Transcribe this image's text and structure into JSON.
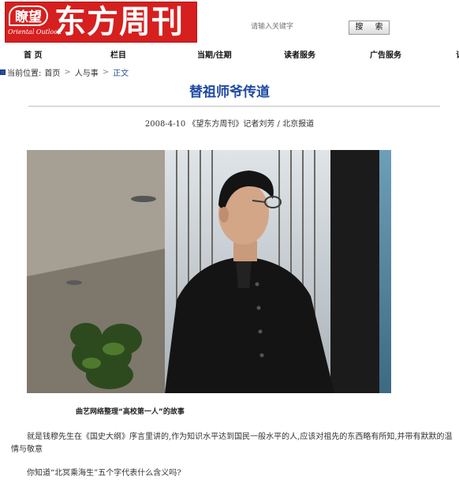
{
  "header": {
    "logo_badge": "瞭望",
    "logo_en": "Oriental Outlook",
    "logo_title": "东方周刊",
    "search_placeholder": "请输入关键字",
    "search_button": "搜 索"
  },
  "nav": {
    "items": [
      "首 页",
      "栏目",
      "当期/往期",
      "读者服务",
      "广告服务",
      "订"
    ]
  },
  "breadcrumb": {
    "prefix": "当前位置:",
    "items": [
      "首页",
      "人与事",
      "正文"
    ]
  },
  "article": {
    "title": "替祖师爷传道",
    "byline": "2008-4-10 《望东方周刊》记者刘芳 / 北京报道",
    "caption": "曲艺网络整理“高校第一人”的故事",
    "paragraphs": [
      "就是钱穆先生在《国史大纲》序言里讲的,作为知识水平达到国民一般水平的人,应该对祖先的东西略有所知,并带有默默的温情与敬意",
      "你知道“北冥乘海生”五个字代表什么含义吗?"
    ]
  },
  "colors": {
    "logo_red": "#d61f1f",
    "title_blue": "#1f4aa3",
    "breadcrumb_current": "#2a4f9b"
  }
}
